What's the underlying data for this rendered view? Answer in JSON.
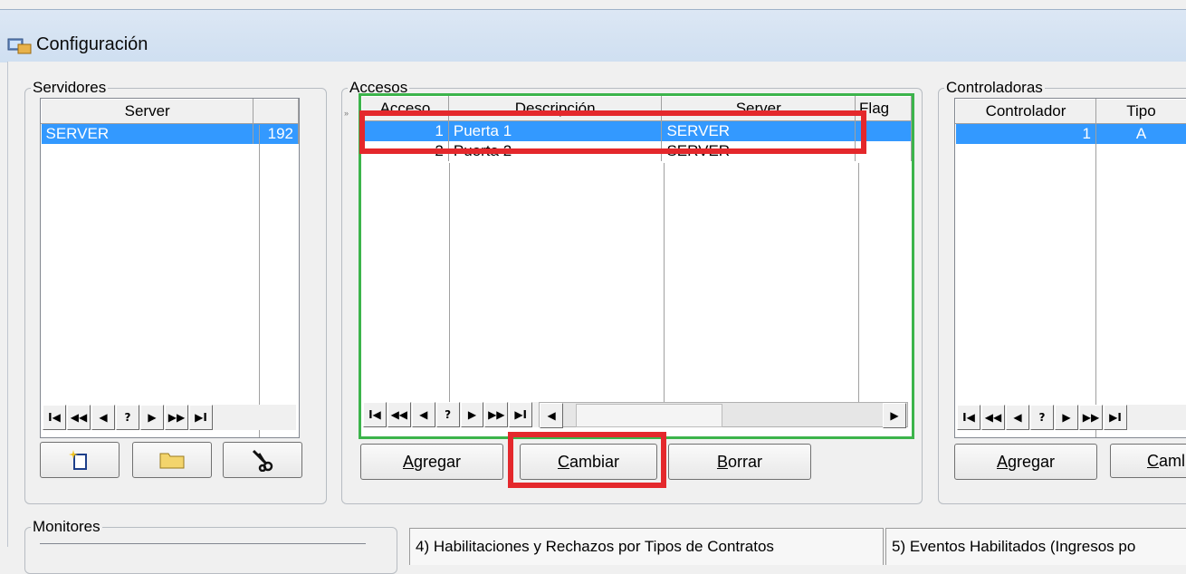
{
  "window": {
    "title": "Configuración"
  },
  "servidores": {
    "legend": "Servidores",
    "columns": [
      "Server",
      ""
    ],
    "rows": [
      {
        "server": "SERVER",
        "ip": "192"
      }
    ]
  },
  "accesos": {
    "legend": "Accesos",
    "columns": [
      "Acceso",
      "Descripción",
      "Server",
      "Flag"
    ],
    "rows": [
      {
        "acceso": "1",
        "descripcion": "Puerta 1",
        "server": "SERVER"
      },
      {
        "acceso": "2",
        "descripcion": "Puerta 2",
        "server": "SERVER"
      }
    ],
    "buttons": {
      "add_pre": "",
      "add_u": "A",
      "add_post": "gregar",
      "change_u": "C",
      "change_post": "ambiar",
      "delete_u": "B",
      "delete_post": "orrar"
    }
  },
  "controladoras": {
    "legend": "Controladoras",
    "columns": [
      "Controlador",
      "Tipo"
    ],
    "rows": [
      {
        "controlador": "1",
        "tipo": "A"
      }
    ],
    "buttons": {
      "add_u": "A",
      "add_post": "gregar",
      "change_u": "C",
      "change_post": "aml"
    }
  },
  "nav_symbols": [
    "I◀",
    "◀◀",
    "◀",
    "?",
    "▶",
    "▶▶",
    "▶I"
  ],
  "monitores": {
    "legend": "Monitores"
  },
  "tabs": [
    "4) Habilitaciones y Rechazos por Tipos de Contratos",
    "5) Eventos Habilitados (Ingresos po"
  ],
  "colors": {
    "selection": "#3399ff",
    "highlight": "#e4282c",
    "active_grid_border": "#3cb44b"
  }
}
